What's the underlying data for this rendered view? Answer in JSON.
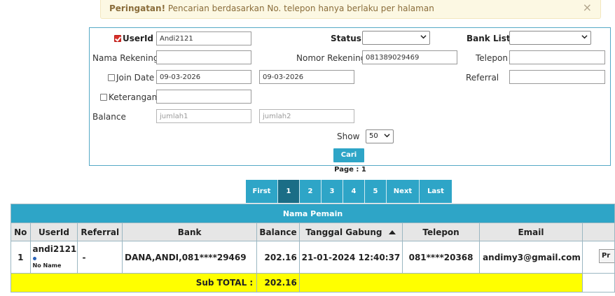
{
  "alert": {
    "title": "Peringatan!",
    "message": " Pencarian berdasarkan No. telepon hanya berlaku per halaman",
    "close_glyph": "×"
  },
  "form": {
    "userid_label": "UserId",
    "userid_value": "Andi2121",
    "status_label": "Status",
    "status_value": "",
    "banklist_label": "Bank List",
    "banklist_value": "",
    "nama_rekening_label": "Nama Rekening",
    "nama_rekening_value": "",
    "nomor_rekening_label": "Nomor Rekening",
    "nomor_rekening_value": "081389029469",
    "telepon_label": "Telepon",
    "telepon_value": "",
    "join_date_label": "Join Date",
    "join_date_from": "09-03-2026",
    "join_date_to": "09-03-2026",
    "referral_label": "Referral",
    "referral_value": "",
    "keterangan_label": "Keterangan",
    "keterangan_value": "",
    "balance_label": "Balance",
    "balance_placeholder1": "jumlah1",
    "balance_placeholder2": "jumlah2",
    "show_label": "Show",
    "show_value": "50",
    "search_button": "Cari"
  },
  "page_info": "Page : 1",
  "pagination": [
    "First",
    "1",
    "2",
    "3",
    "4",
    "5",
    "Next",
    "Last"
  ],
  "table": {
    "title": "Nama Pemain",
    "columns": [
      "No",
      "UserId",
      "Referral",
      "Bank",
      "Balance",
      "Tanggal Gabung",
      "Telepon",
      "Email"
    ],
    "rows": [
      {
        "no": "1",
        "userid": "andi2121",
        "note": "No Name",
        "referral": "-",
        "bank": "DANA,ANDI,081****29469",
        "balance": "202.16",
        "tanggal": "21-01-2024 12:40:37",
        "telepon": "081****20368",
        "email": "andimy3@gmail.com",
        "action": "Pr"
      }
    ],
    "subtotal_label": "Sub TOTAL :",
    "subtotal_value": "202.16"
  },
  "colors": {
    "accent": "#2ea5c7",
    "active_page": "#1b6d86",
    "subtotal_bg": "#ffff00",
    "alert_bg": "#fcf8e3"
  }
}
